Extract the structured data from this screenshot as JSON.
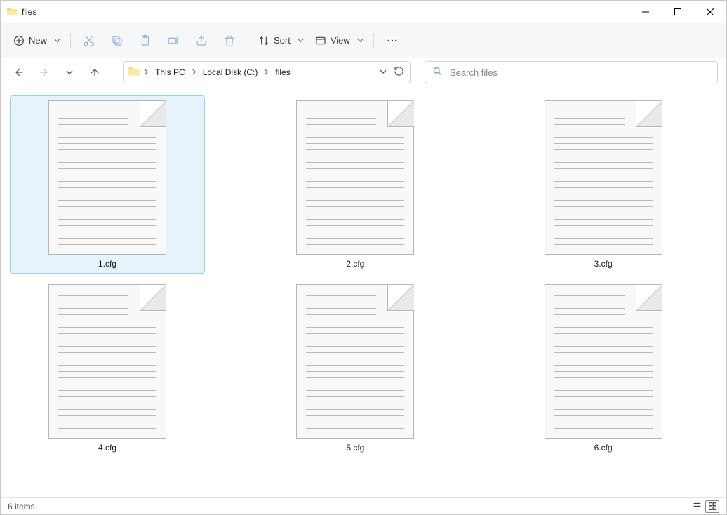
{
  "window": {
    "title": "files"
  },
  "toolbar": {
    "new_label": "New",
    "sort_label": "Sort",
    "view_label": "View"
  },
  "breadcrumb": {
    "seg0": "This PC",
    "seg1": "Local Disk (C:)",
    "seg2": "files"
  },
  "search": {
    "placeholder": "Search files"
  },
  "files": [
    {
      "name": "1.cfg",
      "selected": true
    },
    {
      "name": "2.cfg",
      "selected": false
    },
    {
      "name": "3.cfg",
      "selected": false
    },
    {
      "name": "4.cfg",
      "selected": false
    },
    {
      "name": "5.cfg",
      "selected": false
    },
    {
      "name": "6.cfg",
      "selected": false
    }
  ],
  "status": {
    "item_count_text": "6 items"
  }
}
